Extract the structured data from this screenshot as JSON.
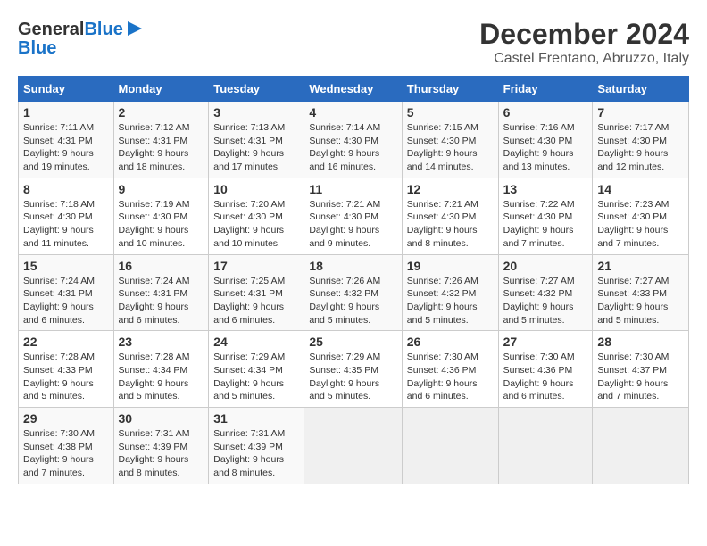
{
  "header": {
    "logo_line1": "General",
    "logo_line2": "Blue",
    "month": "December 2024",
    "location": "Castel Frentano, Abruzzo, Italy"
  },
  "columns": [
    "Sunday",
    "Monday",
    "Tuesday",
    "Wednesday",
    "Thursday",
    "Friday",
    "Saturday"
  ],
  "weeks": [
    [
      {
        "day": "1",
        "sunrise": "7:11 AM",
        "sunset": "4:31 PM",
        "daylight": "9 hours and 19 minutes."
      },
      {
        "day": "2",
        "sunrise": "7:12 AM",
        "sunset": "4:31 PM",
        "daylight": "9 hours and 18 minutes."
      },
      {
        "day": "3",
        "sunrise": "7:13 AM",
        "sunset": "4:31 PM",
        "daylight": "9 hours and 17 minutes."
      },
      {
        "day": "4",
        "sunrise": "7:14 AM",
        "sunset": "4:30 PM",
        "daylight": "9 hours and 16 minutes."
      },
      {
        "day": "5",
        "sunrise": "7:15 AM",
        "sunset": "4:30 PM",
        "daylight": "9 hours and 14 minutes."
      },
      {
        "day": "6",
        "sunrise": "7:16 AM",
        "sunset": "4:30 PM",
        "daylight": "9 hours and 13 minutes."
      },
      {
        "day": "7",
        "sunrise": "7:17 AM",
        "sunset": "4:30 PM",
        "daylight": "9 hours and 12 minutes."
      }
    ],
    [
      {
        "day": "8",
        "sunrise": "7:18 AM",
        "sunset": "4:30 PM",
        "daylight": "9 hours and 11 minutes."
      },
      {
        "day": "9",
        "sunrise": "7:19 AM",
        "sunset": "4:30 PM",
        "daylight": "9 hours and 10 minutes."
      },
      {
        "day": "10",
        "sunrise": "7:20 AM",
        "sunset": "4:30 PM",
        "daylight": "9 hours and 10 minutes."
      },
      {
        "day": "11",
        "sunrise": "7:21 AM",
        "sunset": "4:30 PM",
        "daylight": "9 hours and 9 minutes."
      },
      {
        "day": "12",
        "sunrise": "7:21 AM",
        "sunset": "4:30 PM",
        "daylight": "9 hours and 8 minutes."
      },
      {
        "day": "13",
        "sunrise": "7:22 AM",
        "sunset": "4:30 PM",
        "daylight": "9 hours and 7 minutes."
      },
      {
        "day": "14",
        "sunrise": "7:23 AM",
        "sunset": "4:30 PM",
        "daylight": "9 hours and 7 minutes."
      }
    ],
    [
      {
        "day": "15",
        "sunrise": "7:24 AM",
        "sunset": "4:31 PM",
        "daylight": "9 hours and 6 minutes."
      },
      {
        "day": "16",
        "sunrise": "7:24 AM",
        "sunset": "4:31 PM",
        "daylight": "9 hours and 6 minutes."
      },
      {
        "day": "17",
        "sunrise": "7:25 AM",
        "sunset": "4:31 PM",
        "daylight": "9 hours and 6 minutes."
      },
      {
        "day": "18",
        "sunrise": "7:26 AM",
        "sunset": "4:32 PM",
        "daylight": "9 hours and 5 minutes."
      },
      {
        "day": "19",
        "sunrise": "7:26 AM",
        "sunset": "4:32 PM",
        "daylight": "9 hours and 5 minutes."
      },
      {
        "day": "20",
        "sunrise": "7:27 AM",
        "sunset": "4:32 PM",
        "daylight": "9 hours and 5 minutes."
      },
      {
        "day": "21",
        "sunrise": "7:27 AM",
        "sunset": "4:33 PM",
        "daylight": "9 hours and 5 minutes."
      }
    ],
    [
      {
        "day": "22",
        "sunrise": "7:28 AM",
        "sunset": "4:33 PM",
        "daylight": "9 hours and 5 minutes."
      },
      {
        "day": "23",
        "sunrise": "7:28 AM",
        "sunset": "4:34 PM",
        "daylight": "9 hours and 5 minutes."
      },
      {
        "day": "24",
        "sunrise": "7:29 AM",
        "sunset": "4:34 PM",
        "daylight": "9 hours and 5 minutes."
      },
      {
        "day": "25",
        "sunrise": "7:29 AM",
        "sunset": "4:35 PM",
        "daylight": "9 hours and 5 minutes."
      },
      {
        "day": "26",
        "sunrise": "7:30 AM",
        "sunset": "4:36 PM",
        "daylight": "9 hours and 6 minutes."
      },
      {
        "day": "27",
        "sunrise": "7:30 AM",
        "sunset": "4:36 PM",
        "daylight": "9 hours and 6 minutes."
      },
      {
        "day": "28",
        "sunrise": "7:30 AM",
        "sunset": "4:37 PM",
        "daylight": "9 hours and 7 minutes."
      }
    ],
    [
      {
        "day": "29",
        "sunrise": "7:30 AM",
        "sunset": "4:38 PM",
        "daylight": "9 hours and 7 minutes."
      },
      {
        "day": "30",
        "sunrise": "7:31 AM",
        "sunset": "4:39 PM",
        "daylight": "9 hours and 8 minutes."
      },
      {
        "day": "31",
        "sunrise": "7:31 AM",
        "sunset": "4:39 PM",
        "daylight": "9 hours and 8 minutes."
      },
      null,
      null,
      null,
      null
    ]
  ],
  "labels": {
    "sunrise": "Sunrise:",
    "sunset": "Sunset:",
    "daylight": "Daylight:"
  }
}
